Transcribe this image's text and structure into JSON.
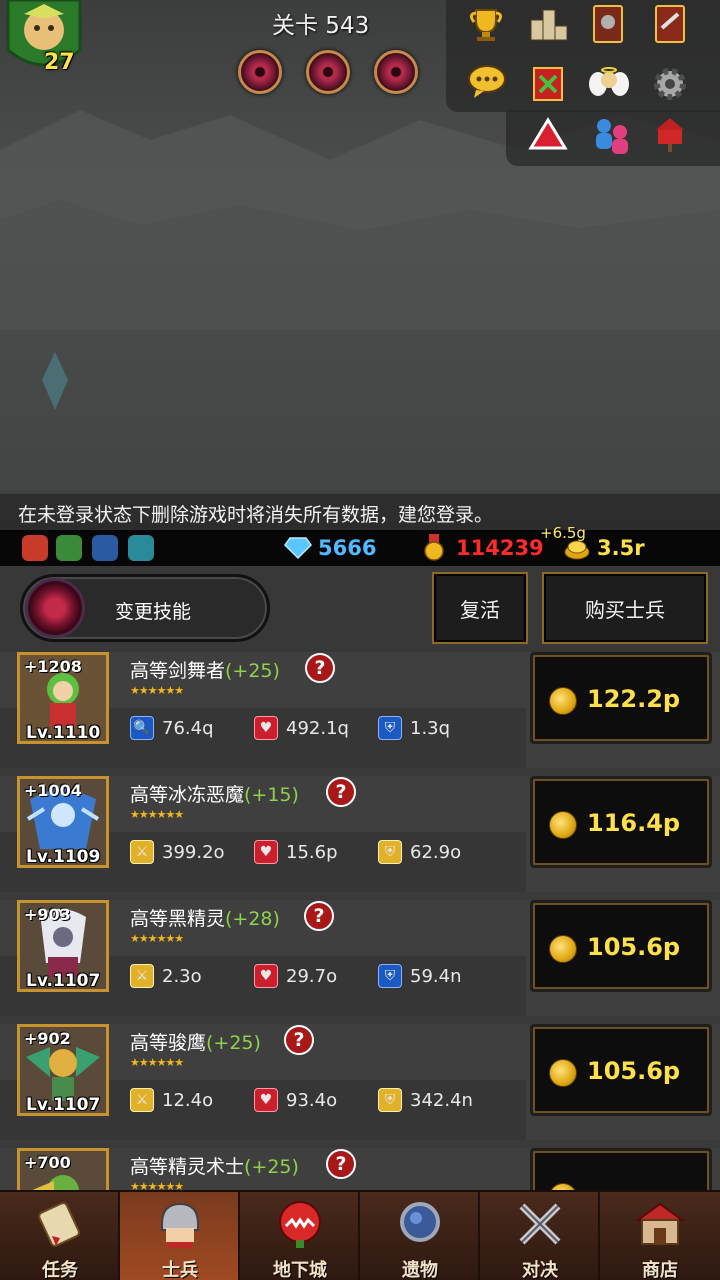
{
  "hud": {
    "hero_level": "27",
    "stage_title": "关卡 543",
    "boss_orbs": [
      "boss-orb",
      "boss-orb",
      "boss-orb"
    ],
    "tool_icons": [
      "trophy-icon",
      "ranking-podium-icon",
      "knight-book-icon",
      "quest-book-icon",
      "chat-icon",
      "guild-banner-icon",
      "angel-icon",
      "gear-icon",
      "warning-triangle-icon",
      "friends-icon",
      "mailbox-icon"
    ]
  },
  "notice": "在未登录状态下删除游戏时将消失所有数据，建您登录。",
  "resources": {
    "gems": "5666",
    "medals": "114239",
    "gold_float": "+6.5g",
    "gold": "3.5r",
    "colors": {
      "gems": "#52b8ff",
      "medals": "#ff2a2a",
      "gold": "#ffe04a"
    }
  },
  "actions": {
    "change_skill": "变更技能",
    "revive": "复活",
    "buy_soldier": "购买士兵"
  },
  "units": [
    {
      "bonus": "+1208",
      "level": "Lv.1110",
      "name": "高等剑舞者",
      "plus": "(+25)",
      "stars": "★★★★★★",
      "atk_icon": "magnifier-icon",
      "atk_style": "atk-blue",
      "atk": "76.4q",
      "hp": "492.1q",
      "def_style": "def-blue",
      "def": "1.3q",
      "price": "122.2p",
      "portrait_color": "#4d8a3a"
    },
    {
      "bonus": "+1004",
      "level": "Lv.1109",
      "name": "高等冰冻恶魔",
      "plus": "(+15)",
      "stars": "★★★★★★",
      "atk_icon": "sword-icon",
      "atk_style": "atk-gold",
      "atk": "399.2o",
      "hp": "15.6p",
      "def_style": "def-gold",
      "def": "62.9o",
      "price": "116.4p",
      "portrait_color": "#2f5fa8"
    },
    {
      "bonus": "+903",
      "level": "Lv.1107",
      "name": "高等黑精灵",
      "plus": "(+28)",
      "stars": "★★★★★★",
      "atk_icon": "sword-icon",
      "atk_style": "atk-gold",
      "atk": "2.3o",
      "hp": "29.7o",
      "def_style": "def-blue",
      "def": "59.4n",
      "price": "105.6p",
      "portrait_color": "#5a5a6e"
    },
    {
      "bonus": "+902",
      "level": "Lv.1107",
      "name": "高等骏鹰",
      "plus": "(+25)",
      "stars": "★★★★★★",
      "atk_icon": "sword-icon",
      "atk_style": "atk-gold",
      "atk": "12.4o",
      "hp": "93.4o",
      "def_style": "def-gold",
      "def": "342.4n",
      "price": "105.6p",
      "portrait_color": "#3a8a6a"
    },
    {
      "bonus": "+700",
      "level": "",
      "name": "高等精灵术士",
      "plus": "(+25)",
      "stars": "★★★★★★",
      "atk_icon": "",
      "atk_style": "",
      "atk": "",
      "hp": "",
      "def_style": "",
      "def": "",
      "price": "",
      "portrait_color": "#5aa040"
    }
  ],
  "nav": [
    {
      "label": "任务",
      "icon": "scroll-icon",
      "active": false
    },
    {
      "label": "士兵",
      "icon": "soldier-helmet-icon",
      "active": true
    },
    {
      "label": "地下城",
      "icon": "monster-plant-icon",
      "active": false
    },
    {
      "label": "遗物",
      "icon": "relic-orb-icon",
      "active": false
    },
    {
      "label": "对决",
      "icon": "crossed-swords-icon",
      "active": false
    },
    {
      "label": "商店",
      "icon": "shop-icon",
      "active": false
    }
  ]
}
